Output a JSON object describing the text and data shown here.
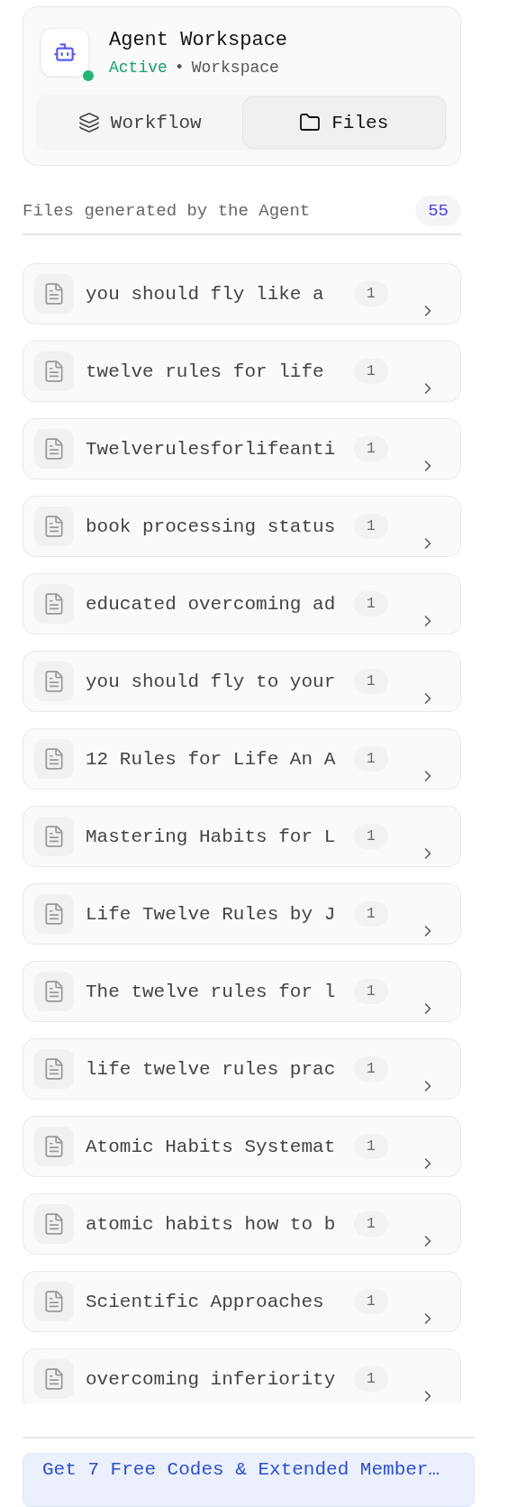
{
  "workspace": {
    "title": "Agent Workspace",
    "status": "Active",
    "status_active": true,
    "separator": "•",
    "subtitle": "Workspace"
  },
  "tabs": [
    {
      "label": "Workflow",
      "kind": "workflow",
      "selected": false
    },
    {
      "label": "Files",
      "kind": "files",
      "selected": true
    }
  ],
  "files_header": {
    "label": "Files generated by the Agent",
    "count": "55"
  },
  "files": [
    {
      "name": "you should fly like a",
      "count": "1"
    },
    {
      "name": "twelve rules for life",
      "count": "1"
    },
    {
      "name": "Twelverulesforlifeanti",
      "count": "1"
    },
    {
      "name": "book processing status",
      "count": "1"
    },
    {
      "name": "educated overcoming ad",
      "count": "1"
    },
    {
      "name": "you should fly to your",
      "count": "1"
    },
    {
      "name": "12 Rules for Life An A",
      "count": "1"
    },
    {
      "name": "Mastering Habits for L",
      "count": "1"
    },
    {
      "name": "Life Twelve Rules by J",
      "count": "1"
    },
    {
      "name": "The twelve rules for l",
      "count": "1"
    },
    {
      "name": "life twelve rules prac",
      "count": "1"
    },
    {
      "name": "Atomic Habits Systemat",
      "count": "1"
    },
    {
      "name": "atomic habits how to b",
      "count": "1"
    },
    {
      "name": "Scientific Approaches",
      "count": "1"
    },
    {
      "name": "overcoming inferiority",
      "count": "1"
    }
  ],
  "promo_banner": {
    "label": "Get 7 Free Codes & Extended Member…"
  }
}
